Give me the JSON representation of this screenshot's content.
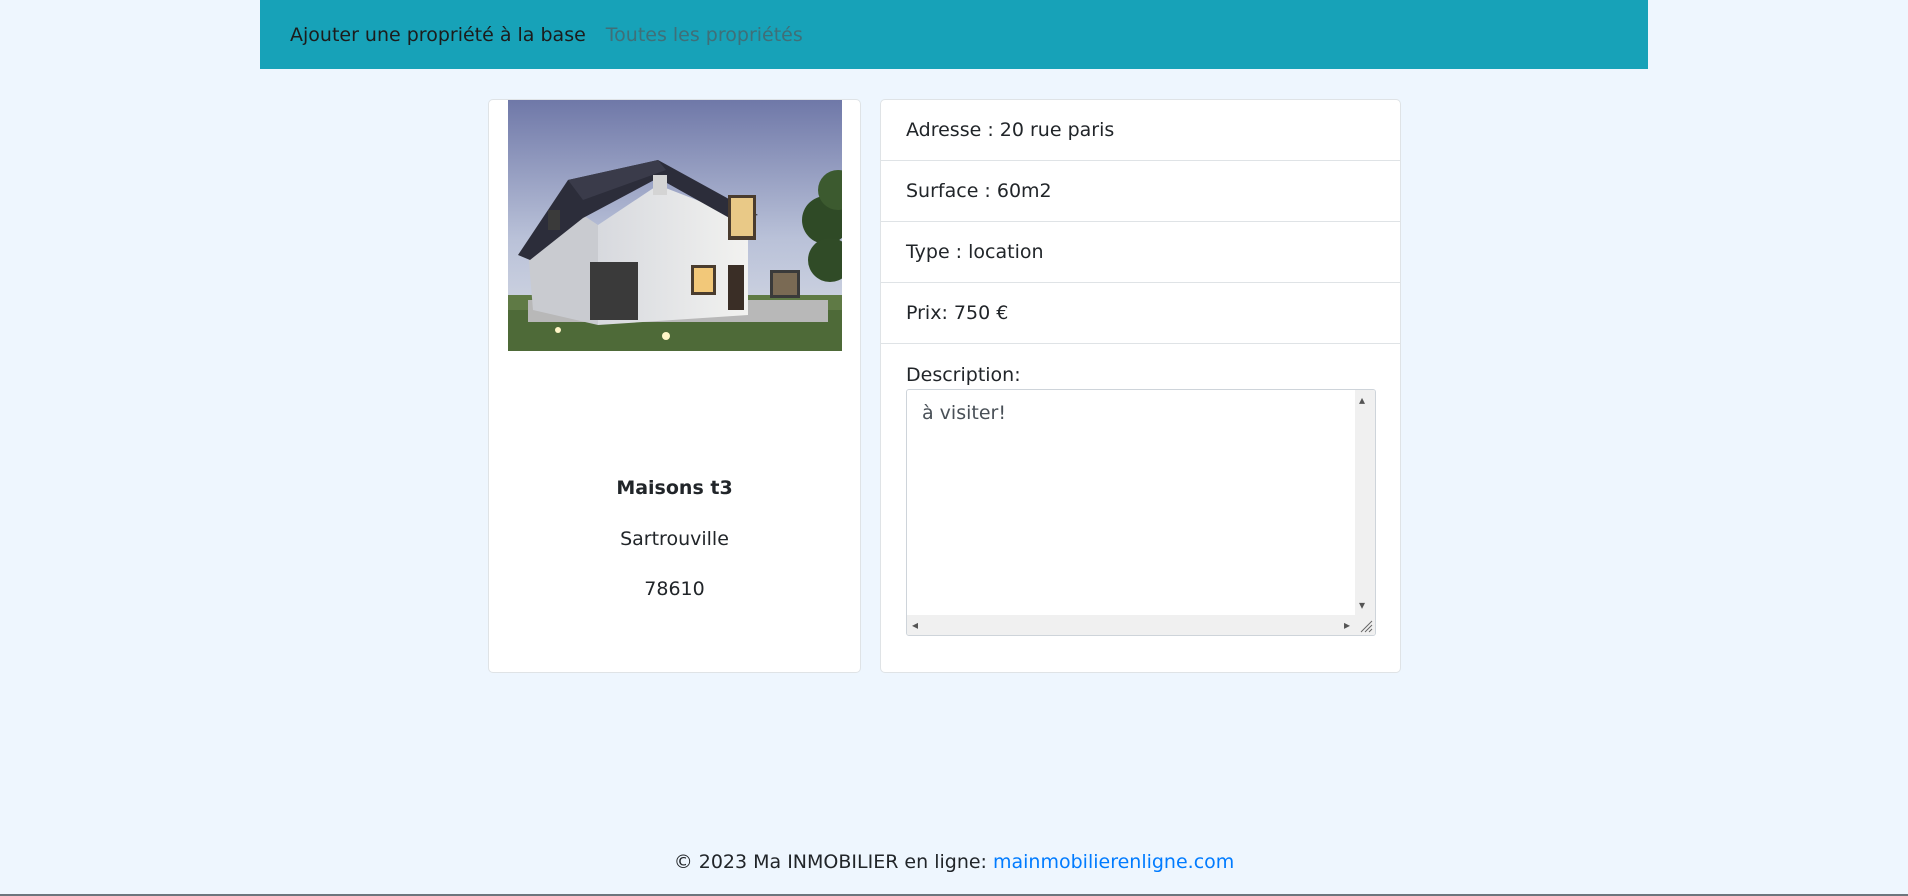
{
  "nav": {
    "add_link": "Ajouter une propriété à la base",
    "all_link": "Toutes les propriétés"
  },
  "property": {
    "title": "Maisons t3",
    "city": "Sartrouville",
    "zip": "78610"
  },
  "details": {
    "address": "Adresse : 20 rue paris",
    "surface": "Surface : 60m2",
    "type": "Type : location",
    "price": "Prix: 750 €",
    "description_label": "Description:",
    "description_value": "à visiter!"
  },
  "footer": {
    "text": "© 2023 Ma INMOBILIER en ligne: ",
    "link": "mainmobilierenligne.com"
  },
  "colors": {
    "navbar": "#17a2b8",
    "background": "#eef6fe",
    "link": "#007bff"
  }
}
